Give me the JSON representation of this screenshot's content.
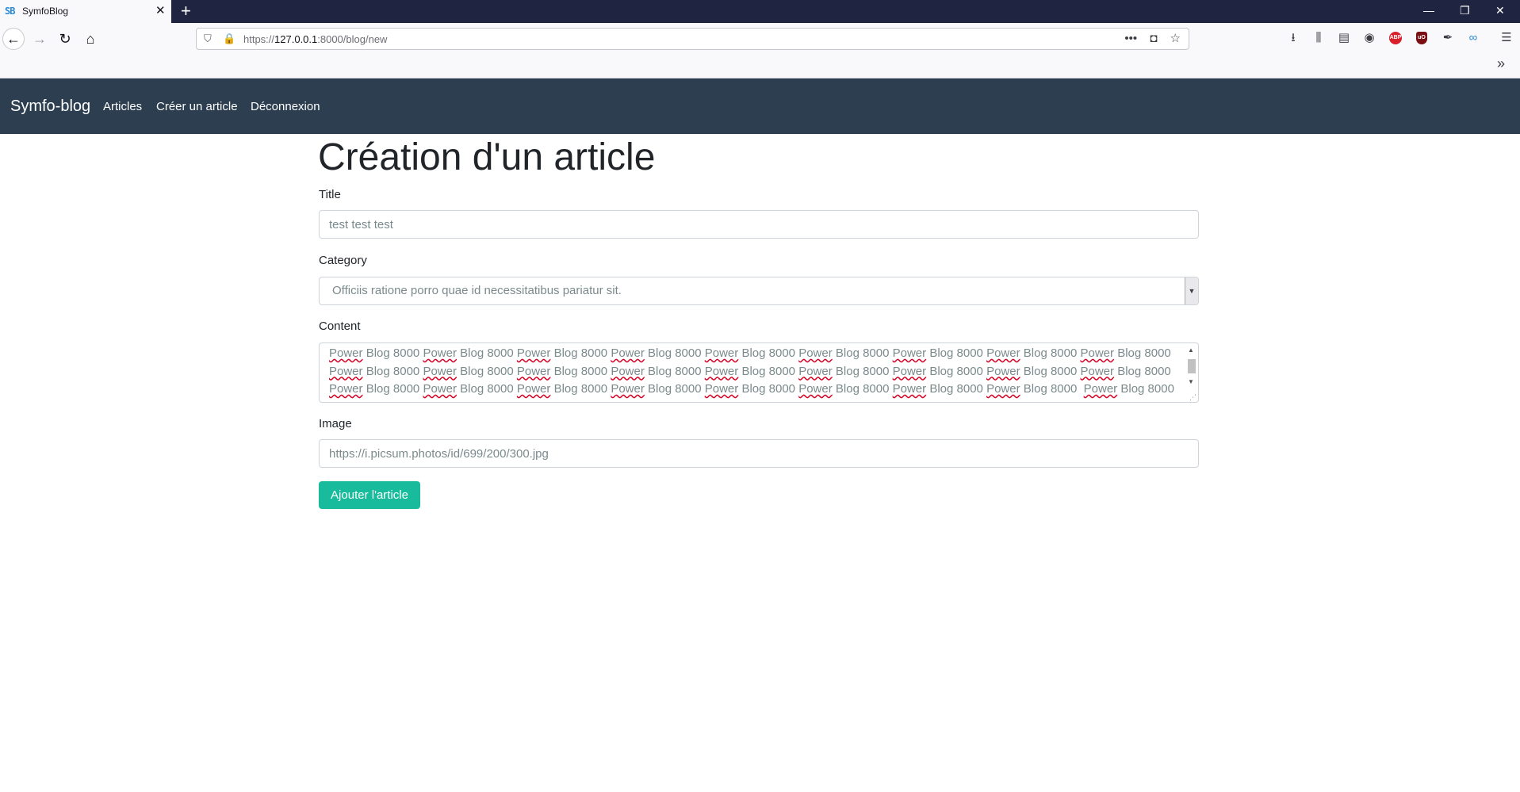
{
  "browser": {
    "tab_title": "SymfoBlog",
    "tab_favicon": "SB",
    "tab_close": "✕",
    "new_tab": "+",
    "url_prefix": "https://",
    "url_host": "127.0.0.1",
    "url_path": ":8000/blog/new",
    "window_controls": [
      "—",
      "❐",
      "✕"
    ],
    "icons": [
      "download-icon",
      "library-icon",
      "sidebar-icon",
      "account-icon",
      "adblock-plus-icon",
      "ublock-origin-icon",
      "eyedropper-icon",
      "extension-icon",
      "menu-icon"
    ],
    "ext_abp": "ABP",
    "ext_ub": "uO"
  },
  "site": {
    "brand": "Symfo-blog",
    "nav": [
      "Articles",
      "Créer un article",
      "Déconnexion"
    ],
    "accent_color": "#18bc9c",
    "navbar_color": "#2c3e50"
  },
  "form": {
    "heading": "Création d'un article",
    "title_label": "Title",
    "title_value": "test test test",
    "category_label": "Category",
    "category_value": "Officiis ratione porro quae id necessitatibus pariatur sit.",
    "content_label": "Content",
    "content_lines": [
      "Power Blog 8000 Power Blog 8000 Power Blog 8000 Power Blog 8000 Power Blog 8000 Power Blog 8000 Power Blog 8000 Power Blog 8000 Power Blog 8000",
      "Power Blog 8000 Power Blog 8000 Power Blog 8000 Power Blog 8000 Power Blog 8000 Power Blog 8000 Power Blog 8000 Power Blog 8000 Power Blog 8000",
      "Power Blog 8000 Power Blog 8000 Power Blog 8000 Power Blog 8000 Power Blog 8000 Power Blog 8000 Power Blog 8000 Power Blog 8000  Power Blog 8000"
    ],
    "image_label": "Image",
    "image_value": "https://i.picsum.photos/id/699/200/300.jpg",
    "submit_label": "Ajouter l'article"
  }
}
